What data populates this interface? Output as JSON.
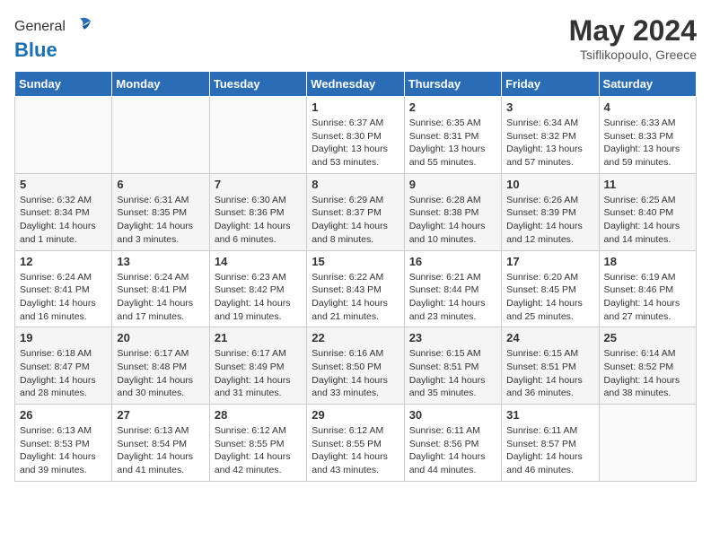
{
  "header": {
    "logo_general": "General",
    "logo_blue": "Blue",
    "month_year": "May 2024",
    "location": "Tsiflikopoulo, Greece"
  },
  "days_of_week": [
    "Sunday",
    "Monday",
    "Tuesday",
    "Wednesday",
    "Thursday",
    "Friday",
    "Saturday"
  ],
  "weeks": [
    [
      {
        "day": "",
        "info": ""
      },
      {
        "day": "",
        "info": ""
      },
      {
        "day": "",
        "info": ""
      },
      {
        "day": "1",
        "info": "Sunrise: 6:37 AM\nSunset: 8:30 PM\nDaylight: 13 hours\nand 53 minutes."
      },
      {
        "day": "2",
        "info": "Sunrise: 6:35 AM\nSunset: 8:31 PM\nDaylight: 13 hours\nand 55 minutes."
      },
      {
        "day": "3",
        "info": "Sunrise: 6:34 AM\nSunset: 8:32 PM\nDaylight: 13 hours\nand 57 minutes."
      },
      {
        "day": "4",
        "info": "Sunrise: 6:33 AM\nSunset: 8:33 PM\nDaylight: 13 hours\nand 59 minutes."
      }
    ],
    [
      {
        "day": "5",
        "info": "Sunrise: 6:32 AM\nSunset: 8:34 PM\nDaylight: 14 hours\nand 1 minute."
      },
      {
        "day": "6",
        "info": "Sunrise: 6:31 AM\nSunset: 8:35 PM\nDaylight: 14 hours\nand 3 minutes."
      },
      {
        "day": "7",
        "info": "Sunrise: 6:30 AM\nSunset: 8:36 PM\nDaylight: 14 hours\nand 6 minutes."
      },
      {
        "day": "8",
        "info": "Sunrise: 6:29 AM\nSunset: 8:37 PM\nDaylight: 14 hours\nand 8 minutes."
      },
      {
        "day": "9",
        "info": "Sunrise: 6:28 AM\nSunset: 8:38 PM\nDaylight: 14 hours\nand 10 minutes."
      },
      {
        "day": "10",
        "info": "Sunrise: 6:26 AM\nSunset: 8:39 PM\nDaylight: 14 hours\nand 12 minutes."
      },
      {
        "day": "11",
        "info": "Sunrise: 6:25 AM\nSunset: 8:40 PM\nDaylight: 14 hours\nand 14 minutes."
      }
    ],
    [
      {
        "day": "12",
        "info": "Sunrise: 6:24 AM\nSunset: 8:41 PM\nDaylight: 14 hours\nand 16 minutes."
      },
      {
        "day": "13",
        "info": "Sunrise: 6:24 AM\nSunset: 8:41 PM\nDaylight: 14 hours\nand 17 minutes."
      },
      {
        "day": "14",
        "info": "Sunrise: 6:23 AM\nSunset: 8:42 PM\nDaylight: 14 hours\nand 19 minutes."
      },
      {
        "day": "15",
        "info": "Sunrise: 6:22 AM\nSunset: 8:43 PM\nDaylight: 14 hours\nand 21 minutes."
      },
      {
        "day": "16",
        "info": "Sunrise: 6:21 AM\nSunset: 8:44 PM\nDaylight: 14 hours\nand 23 minutes."
      },
      {
        "day": "17",
        "info": "Sunrise: 6:20 AM\nSunset: 8:45 PM\nDaylight: 14 hours\nand 25 minutes."
      },
      {
        "day": "18",
        "info": "Sunrise: 6:19 AM\nSunset: 8:46 PM\nDaylight: 14 hours\nand 27 minutes."
      }
    ],
    [
      {
        "day": "19",
        "info": "Sunrise: 6:18 AM\nSunset: 8:47 PM\nDaylight: 14 hours\nand 28 minutes."
      },
      {
        "day": "20",
        "info": "Sunrise: 6:17 AM\nSunset: 8:48 PM\nDaylight: 14 hours\nand 30 minutes."
      },
      {
        "day": "21",
        "info": "Sunrise: 6:17 AM\nSunset: 8:49 PM\nDaylight: 14 hours\nand 31 minutes."
      },
      {
        "day": "22",
        "info": "Sunrise: 6:16 AM\nSunset: 8:50 PM\nDaylight: 14 hours\nand 33 minutes."
      },
      {
        "day": "23",
        "info": "Sunrise: 6:15 AM\nSunset: 8:51 PM\nDaylight: 14 hours\nand 35 minutes."
      },
      {
        "day": "24",
        "info": "Sunrise: 6:15 AM\nSunset: 8:51 PM\nDaylight: 14 hours\nand 36 minutes."
      },
      {
        "day": "25",
        "info": "Sunrise: 6:14 AM\nSunset: 8:52 PM\nDaylight: 14 hours\nand 38 minutes."
      }
    ],
    [
      {
        "day": "26",
        "info": "Sunrise: 6:13 AM\nSunset: 8:53 PM\nDaylight: 14 hours\nand 39 minutes."
      },
      {
        "day": "27",
        "info": "Sunrise: 6:13 AM\nSunset: 8:54 PM\nDaylight: 14 hours\nand 41 minutes."
      },
      {
        "day": "28",
        "info": "Sunrise: 6:12 AM\nSunset: 8:55 PM\nDaylight: 14 hours\nand 42 minutes."
      },
      {
        "day": "29",
        "info": "Sunrise: 6:12 AM\nSunset: 8:55 PM\nDaylight: 14 hours\nand 43 minutes."
      },
      {
        "day": "30",
        "info": "Sunrise: 6:11 AM\nSunset: 8:56 PM\nDaylight: 14 hours\nand 44 minutes."
      },
      {
        "day": "31",
        "info": "Sunrise: 6:11 AM\nSunset: 8:57 PM\nDaylight: 14 hours\nand 46 minutes."
      },
      {
        "day": "",
        "info": ""
      }
    ]
  ]
}
